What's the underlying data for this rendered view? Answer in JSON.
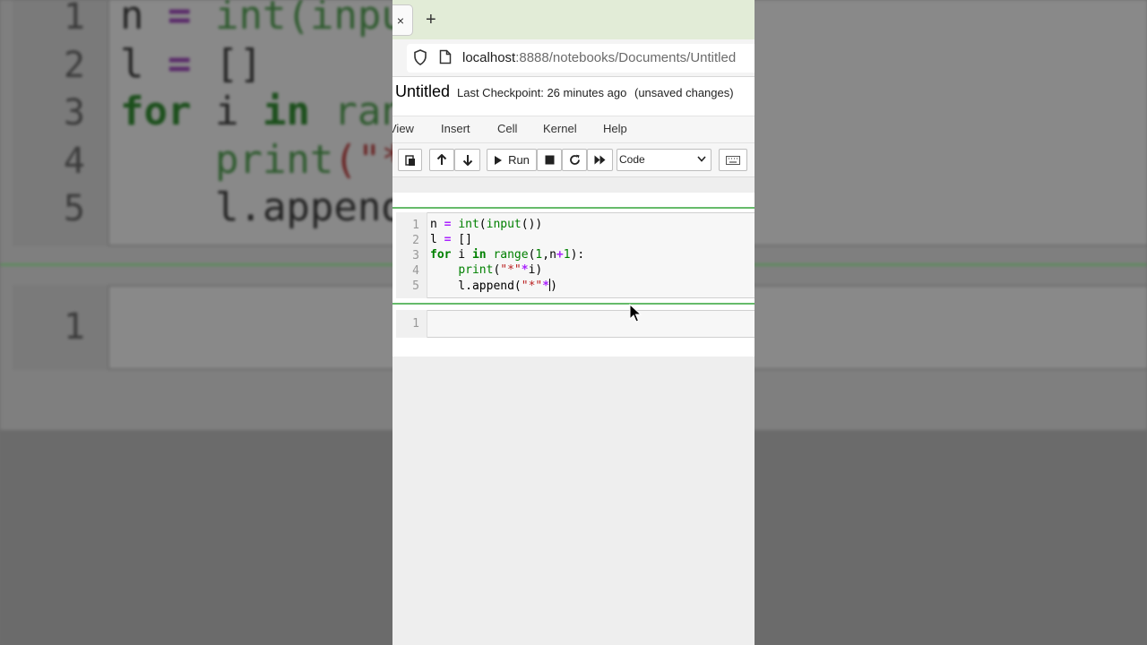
{
  "background_zoom": {
    "line_numbers": [
      "1",
      "2",
      "3",
      "4",
      "5"
    ],
    "lines": [
      [
        {
          "t": "n ",
          "c": ""
        },
        {
          "t": "=",
          "c": "k-op"
        },
        {
          "t": " int",
          "c": "k-bi"
        },
        {
          "t": "(inpu",
          "c": "k-bi"
        }
      ],
      [
        {
          "t": "l ",
          "c": ""
        },
        {
          "t": "=",
          "c": "k-op"
        },
        {
          "t": " []",
          "c": ""
        }
      ],
      [
        {
          "t": "for",
          "c": "k-kw"
        },
        {
          "t": " i ",
          "c": ""
        },
        {
          "t": "in",
          "c": "k-kw"
        },
        {
          "t": " ran",
          "c": "k-bi"
        }
      ],
      [
        {
          "t": "    print",
          "c": "k-bi"
        },
        {
          "t": "(\"*",
          "c": "k-str"
        }
      ],
      [
        {
          "t": "    l.append",
          "c": ""
        }
      ]
    ],
    "next_cell_line_number": "1"
  },
  "browser": {
    "tab_close": "×",
    "new_tab": "+",
    "url_host": "localhost",
    "url_rest": ":8888/notebooks/Documents/Untitled"
  },
  "notebook": {
    "title": "Untitled",
    "checkpoint": "Last Checkpoint: 26 minutes ago",
    "status": "(unsaved changes)",
    "menu": [
      "View",
      "Insert",
      "Cell",
      "Kernel",
      "Help"
    ],
    "toolbar": {
      "run_label": "Run",
      "cell_type": "Code"
    }
  },
  "cells": [
    {
      "line_numbers": [
        "1",
        "2",
        "3",
        "4",
        "5"
      ],
      "lines": [
        [
          {
            "t": "n ",
            "c": ""
          },
          {
            "t": "=",
            "c": "op"
          },
          {
            "t": " ",
            "c": ""
          },
          {
            "t": "int",
            "c": "bi"
          },
          {
            "t": "(",
            "c": ""
          },
          {
            "t": "input",
            "c": "bi"
          },
          {
            "t": "())",
            "c": ""
          }
        ],
        [
          {
            "t": "l ",
            "c": ""
          },
          {
            "t": "=",
            "c": "op"
          },
          {
            "t": " []",
            "c": ""
          }
        ],
        [
          {
            "t": "for",
            "c": "kw"
          },
          {
            "t": " i ",
            "c": ""
          },
          {
            "t": "in",
            "c": "kw"
          },
          {
            "t": " ",
            "c": ""
          },
          {
            "t": "range",
            "c": "bi"
          },
          {
            "t": "(",
            "c": ""
          },
          {
            "t": "1",
            "c": "num"
          },
          {
            "t": ",n",
            "c": ""
          },
          {
            "t": "+",
            "c": "op"
          },
          {
            "t": "1",
            "c": "num"
          },
          {
            "t": "):",
            "c": ""
          }
        ],
        [
          {
            "t": "    ",
            "c": ""
          },
          {
            "t": "print",
            "c": "bi"
          },
          {
            "t": "(",
            "c": ""
          },
          {
            "t": "\"*\"",
            "c": "str"
          },
          {
            "t": "*",
            "c": "op"
          },
          {
            "t": "i)",
            "c": ""
          }
        ],
        [
          {
            "t": "    l.append(",
            "c": ""
          },
          {
            "t": "\"*\"",
            "c": "str"
          },
          {
            "t": "*",
            "c": "op"
          },
          {
            "t": "|",
            "c": "caret"
          },
          {
            "t": ")",
            "c": ""
          }
        ]
      ]
    },
    {
      "line_numbers": [
        "1"
      ],
      "lines": []
    }
  ]
}
